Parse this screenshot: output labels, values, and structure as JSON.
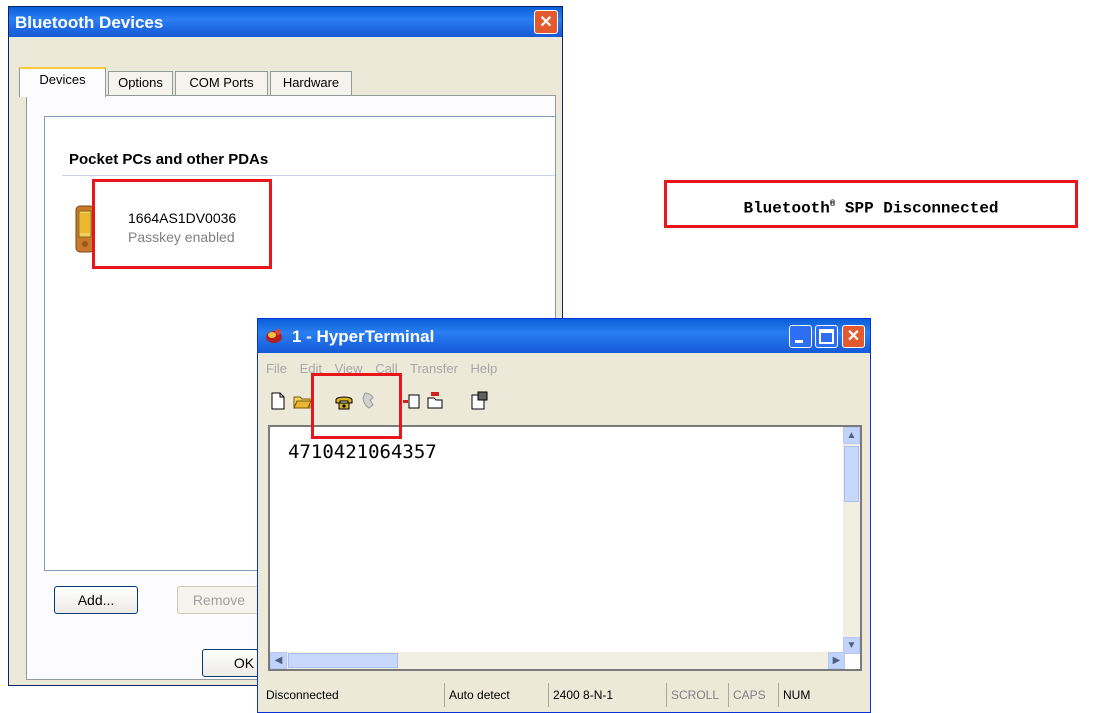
{
  "bluetooth_dialog": {
    "title": "Bluetooth Devices",
    "close_glyph": "✕",
    "tabs": [
      {
        "label": "Devices",
        "active": true
      },
      {
        "label": "Options"
      },
      {
        "label": "COM Ports"
      },
      {
        "label": "Hardware"
      }
    ],
    "group_header": "Pocket PCs and other PDAs",
    "device": {
      "name": "1664AS1DV0036",
      "status": "Passkey enabled",
      "icon": "pda-icon"
    },
    "buttons": {
      "add": "Add...",
      "remove": "Remove",
      "ok": "OK"
    }
  },
  "hyperterminal": {
    "title": "1 - HyperTerminal",
    "menu": [
      "File",
      "Edit",
      "View",
      "Call",
      "Transfer",
      "Help"
    ],
    "toolbar": [
      "new-icon",
      "open-icon",
      "call-icon",
      "disconnect-icon",
      "send-icon",
      "receive-icon",
      "properties-icon"
    ],
    "terminal_text": "4710421064357",
    "status_bar": [
      "Disconnected",
      "Auto detect",
      "2400 8-N-1",
      "SCROLL",
      "CAPS",
      "NUM"
    ]
  },
  "annotation": {
    "brand": "Bluetooth",
    "mark": "®",
    "rest": " SPP Disconnected",
    "color": "#e8151b"
  }
}
